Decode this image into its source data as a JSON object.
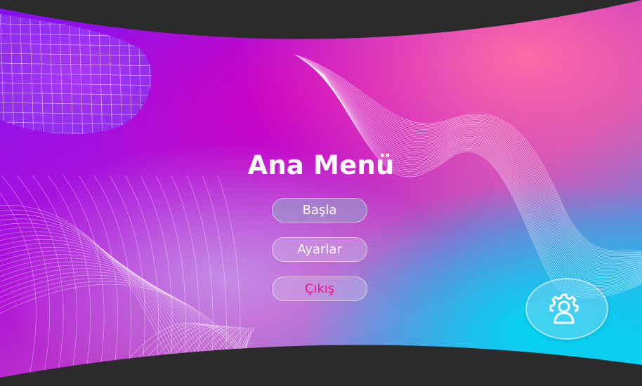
{
  "menu": {
    "title": "Ana Menü",
    "start_label": "Başla",
    "settings_label": "Ayarlar",
    "exit_label": "Çıkış"
  },
  "settings_fab": {
    "icon": "user-gear-icon"
  },
  "colors": {
    "frame": "#2b2b2b",
    "purple": "#8a10e8",
    "magenta": "#c400c8",
    "pink": "#ff5aa8",
    "cyan": "#00c8f0",
    "exit_text": "#e8148f"
  }
}
